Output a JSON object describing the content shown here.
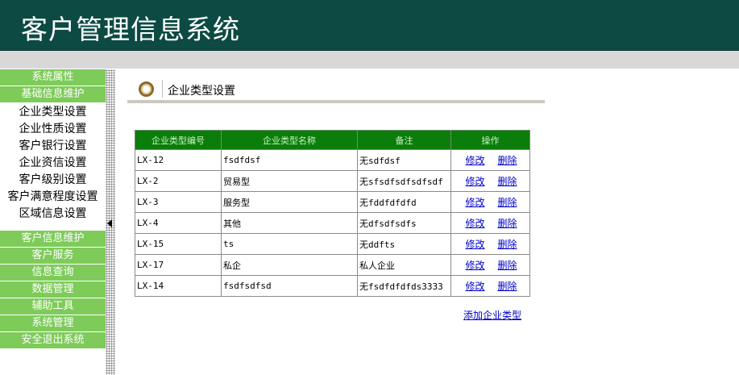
{
  "app": {
    "title": "客户管理信息系统"
  },
  "sidebar": {
    "top_sections": [
      "系统属性",
      "基础信息维护"
    ],
    "sub_items": [
      "企业类型设置",
      "企业性质设置",
      "客户银行设置",
      "企业资信设置",
      "客户级别设置",
      "客户满意程度设置",
      "区域信息设置"
    ],
    "bottom_sections": [
      "客户信息维护",
      "客户服务",
      "信息查询",
      "数据管理",
      "辅助工具",
      "系统管理",
      "安全退出系统"
    ]
  },
  "page": {
    "title": "企业类型设置",
    "icon": "ring-icon"
  },
  "table": {
    "headers": [
      "企业类型编号",
      "企业类型名称",
      "备注",
      "操作"
    ],
    "rows": [
      {
        "id": "LX-12",
        "name": "fsdfdsf",
        "note": "无sdfdsf"
      },
      {
        "id": "LX-2",
        "name": "贸易型",
        "note": "无sfsdfsdfsdfsdf"
      },
      {
        "id": "LX-3",
        "name": "服务型",
        "note": "无fddfdfdfd"
      },
      {
        "id": "LX-4",
        "name": "其他",
        "note": "无dfsdfsdfs"
      },
      {
        "id": "LX-15",
        "name": "ts",
        "note": "无ddfts"
      },
      {
        "id": "LX-17",
        "name": "私企",
        "note": "私人企业"
      },
      {
        "id": "LX-14",
        "name": "fsdfsdfsd",
        "note": "无fsdfdfdfds3333"
      }
    ],
    "edit_label": "修改",
    "delete_label": "删除"
  },
  "add_link": "添加企业类型",
  "colors": {
    "header_bg": "#0d4a44",
    "sidebar_green": "#7ecb5a",
    "table_header": "#0b7d0b",
    "link": "#0000cc"
  }
}
